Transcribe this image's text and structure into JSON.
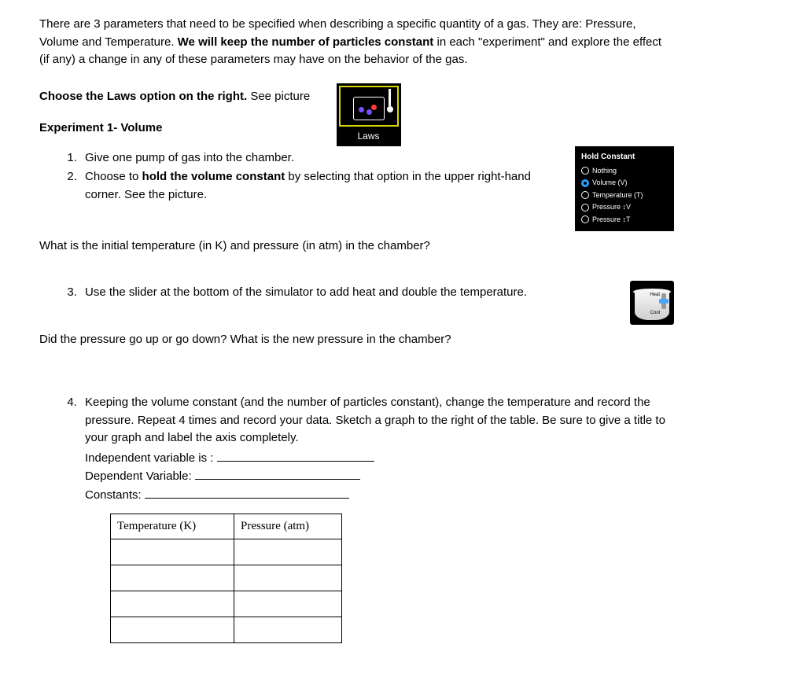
{
  "intro": {
    "part1": "There are 3 parameters that need to be specified when describing a specific quantity of a gas. They are: Pressure, Volume and Temperature. ",
    "bold": "We will keep the number of particles constant",
    "part2": " in each \"experiment\" and explore the effect (if any) a change in any of these parameters may have on the behavior of the gas."
  },
  "choose": {
    "bold": "Choose the Laws option on the right.",
    "rest": " See picture"
  },
  "laws_label": "Laws",
  "exp1_heading": "Experiment 1- Volume",
  "steps12": {
    "s1": "Give one pump of gas into the chamber.",
    "s2a": "Choose to ",
    "s2b_bold": "hold the volume constant",
    "s2c": " by selecting that option in the upper right-hand corner. See the picture."
  },
  "hold_panel": {
    "title": "Hold Constant",
    "opts": [
      "Nothing",
      "Volume (V)",
      "Temperature (T)",
      "Pressure ↕V",
      "Pressure ↕T"
    ],
    "selected_index": 1
  },
  "q_initial": "What is the initial temperature (in K) and pressure (in atm) in the chamber?",
  "step3": "Use the slider at the bottom of the simulator to add heat and double the temperature.",
  "bucket": {
    "heat": "Heat",
    "cool": "Cool"
  },
  "q_pressure": "Did the pressure go up or go down? What is the new pressure in the chamber?",
  "step4": "Keeping the volume constant (and the number of particles constant), change the temperature and record the pressure. Repeat 4 times and record your data. Sketch a graph to the right of the table. Be sure to give a title to your graph and label the axis completely.",
  "vars": {
    "iv_label": "Independent variable is :",
    "dv_label": "Dependent Variable:",
    "c_label": "Constants:"
  },
  "table": {
    "headers": [
      "Temperature (K)",
      "Pressure (atm)"
    ],
    "rows": 4
  }
}
